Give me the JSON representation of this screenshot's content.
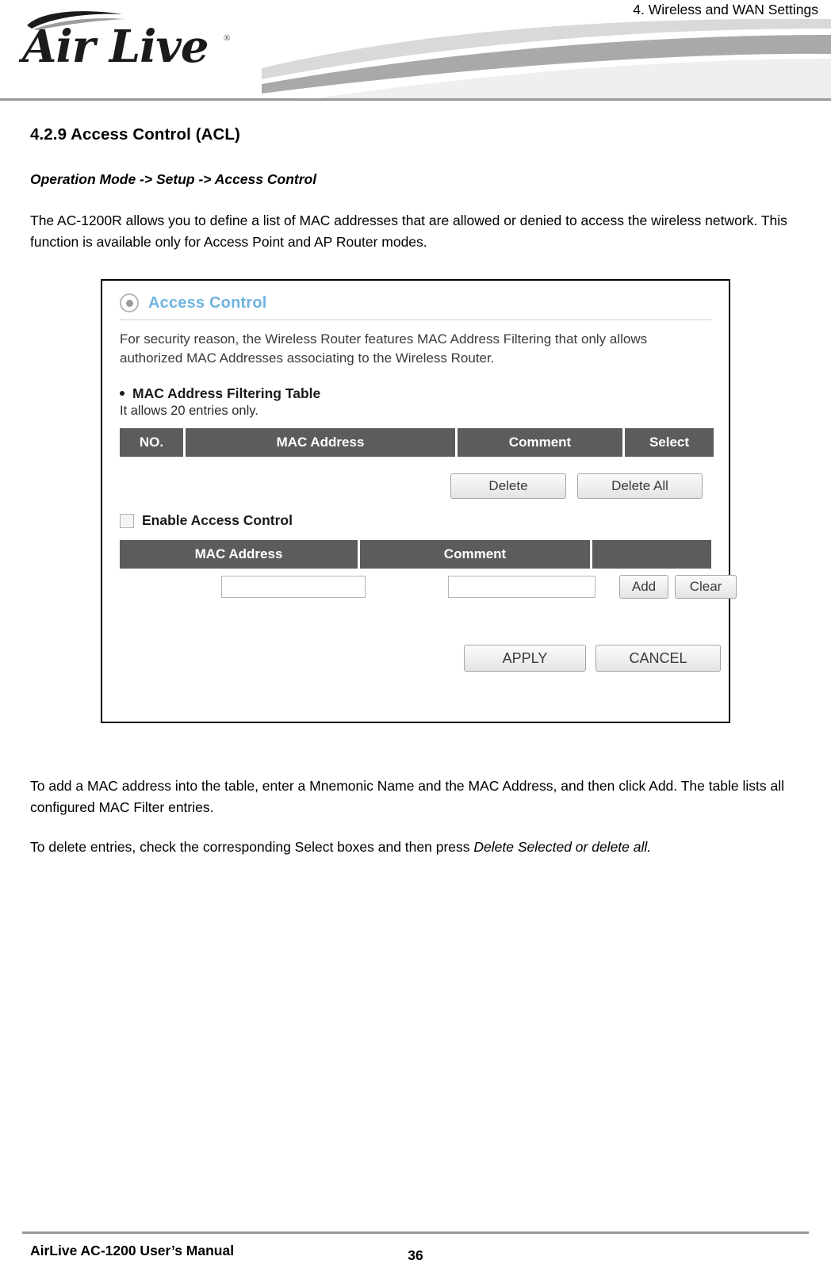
{
  "header": {
    "running_head": "4. Wireless and WAN Settings",
    "logo_text": "Air Live",
    "logo_registered": "®"
  },
  "document": {
    "section_title": "4.2.9 Access Control (ACL)",
    "breadcrumb": "Operation Mode -> Setup -> Access Control",
    "intro_paragraph": "The AC-1200R allows you to define a list of MAC addresses that are allowed or denied to access the wireless network. This function is available only for Access Point and AP Router modes.",
    "after_paragraph_1": "To add a MAC address into the table, enter a Mnemonic Name and the MAC Address, and then click Add. The table lists all configured MAC Filter entries.",
    "after_paragraph_2_prefix": "To delete entries, check the corresponding Select boxes and then press ",
    "after_paragraph_2_italic": "Delete Selected or delete all."
  },
  "screenshot": {
    "panel_title": "Access Control",
    "description": "For security reason, the Wireless Router features MAC Address Filtering that only allows authorized MAC Addresses associating to the Wireless Router.",
    "filter_table_heading": "MAC Address Filtering Table",
    "filter_table_note": "It allows 20 entries only.",
    "table_headers": {
      "no": "NO.",
      "mac_address": "MAC Address",
      "comment": "Comment",
      "select": "Select"
    },
    "buttons": {
      "delete": "Delete",
      "delete_all": "Delete All",
      "add": "Add",
      "clear": "Clear",
      "apply": "APPLY",
      "cancel": "CANCEL"
    },
    "enable_access_control_label": "Enable Access Control",
    "enable_access_control_checked": false,
    "entry_table_headers": {
      "mac_address": "MAC Address",
      "comment": "Comment",
      "blank": ""
    },
    "inputs": {
      "mac_address_value": "",
      "comment_value": ""
    }
  },
  "footer": {
    "manual_name": "AirLive AC-1200 User’s Manual",
    "page_number": "36"
  }
}
